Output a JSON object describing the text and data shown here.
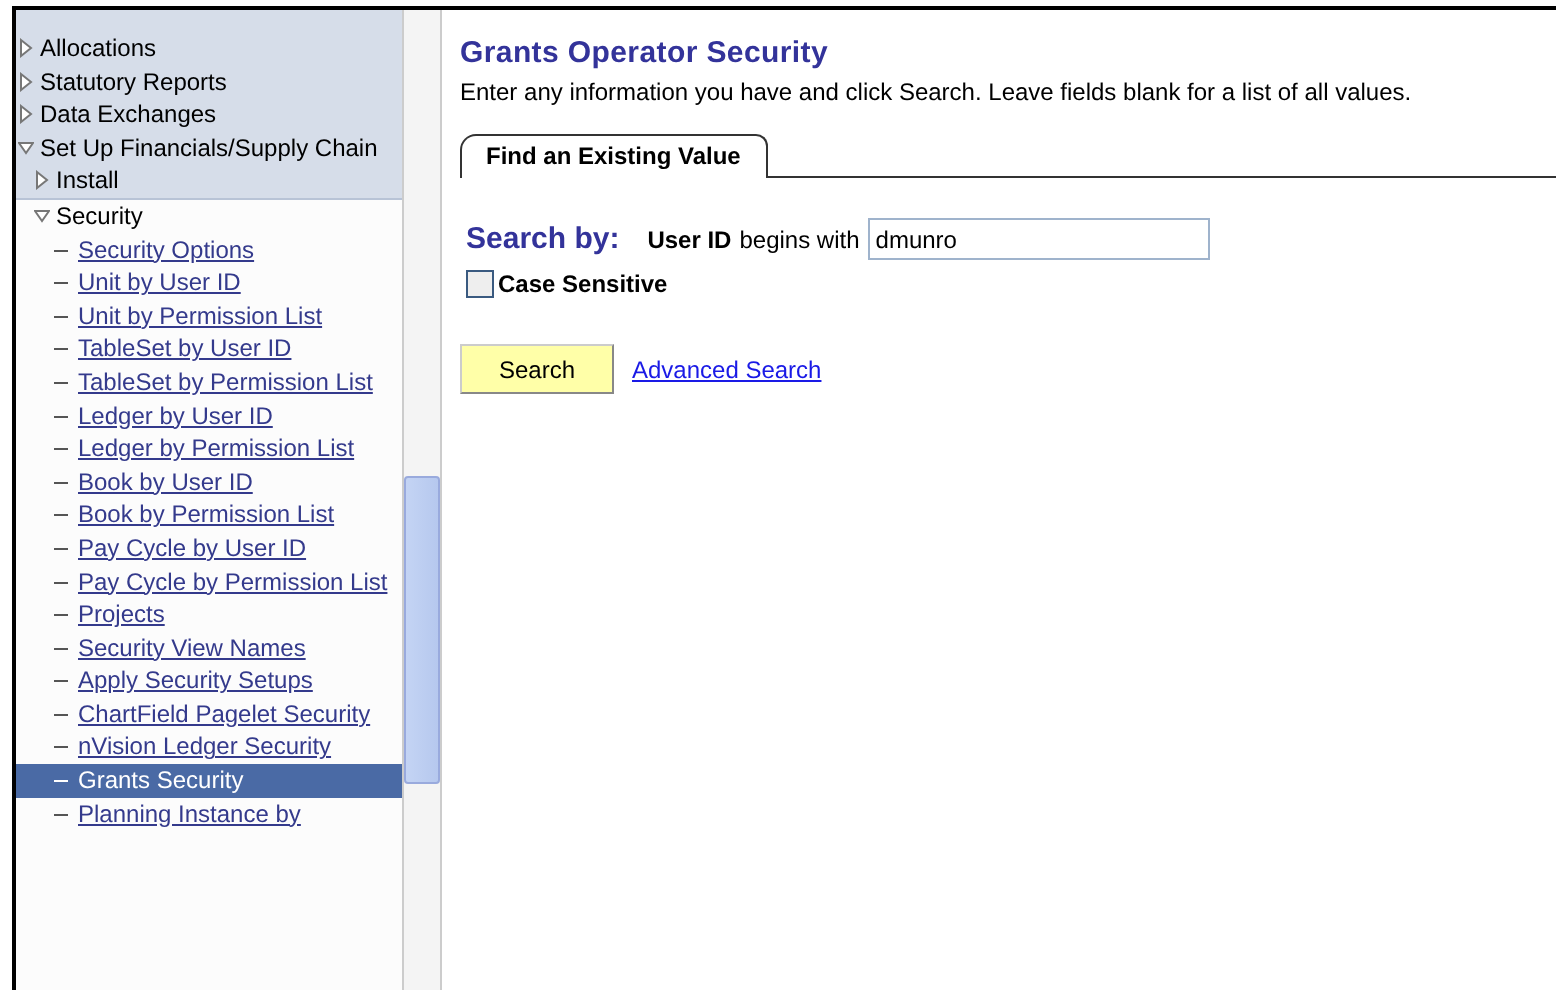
{
  "navigation": {
    "items": [
      {
        "label": "Allocations",
        "kind": "folder",
        "expanded": false
      },
      {
        "label": "Statutory Reports",
        "kind": "folder",
        "expanded": false
      },
      {
        "label": "Data Exchanges",
        "kind": "folder",
        "expanded": false
      },
      {
        "label": "Set Up Financials/Supply Chain",
        "kind": "folder",
        "expanded": true,
        "children": [
          {
            "label": "Install",
            "kind": "folder",
            "expanded": false
          },
          {
            "label": "Security",
            "kind": "folder",
            "expanded": true,
            "children": [
              {
                "label": "Security Options",
                "kind": "link",
                "selected": false
              },
              {
                "label": "Unit by User ID",
                "kind": "link",
                "selected": false
              },
              {
                "label": "Unit by Permission List",
                "kind": "link",
                "selected": false
              },
              {
                "label": "TableSet by User ID",
                "kind": "link",
                "selected": false
              },
              {
                "label": "TableSet by Permission List",
                "kind": "link",
                "selected": false
              },
              {
                "label": "Ledger by User ID",
                "kind": "link",
                "selected": false
              },
              {
                "label": "Ledger by Permission List",
                "kind": "link",
                "selected": false
              },
              {
                "label": "Book by User ID",
                "kind": "link",
                "selected": false
              },
              {
                "label": "Book by Permission List",
                "kind": "link",
                "selected": false
              },
              {
                "label": "Pay Cycle by User ID",
                "kind": "link",
                "selected": false
              },
              {
                "label": "Pay Cycle by Permission List",
                "kind": "link",
                "selected": false
              },
              {
                "label": "Projects",
                "kind": "link",
                "selected": false
              },
              {
                "label": "Security View Names",
                "kind": "link",
                "selected": false
              },
              {
                "label": "Apply Security Setups",
                "kind": "link",
                "selected": false
              },
              {
                "label": "ChartField Pagelet Security",
                "kind": "link",
                "selected": false
              },
              {
                "label": "nVision Ledger Security",
                "kind": "link",
                "selected": false
              },
              {
                "label": "Grants Security",
                "kind": "link",
                "selected": true
              },
              {
                "label": "Planning Instance by",
                "kind": "link",
                "selected": false
              }
            ]
          }
        ]
      }
    ]
  },
  "page": {
    "title": "Grants Operator Security",
    "instructions": "Enter any information you have and click Search. Leave fields blank for a list of all values.",
    "tabs": [
      {
        "label": "Find an Existing Value",
        "selected": true
      }
    ],
    "search_by_label": "Search by:",
    "field_label": "User ID",
    "operator": "begins with",
    "value": "dmunro",
    "case_sensitive": {
      "label": "Case Sensitive",
      "checked": false
    },
    "search_button": "Search",
    "advanced_link": "Advanced Search"
  }
}
